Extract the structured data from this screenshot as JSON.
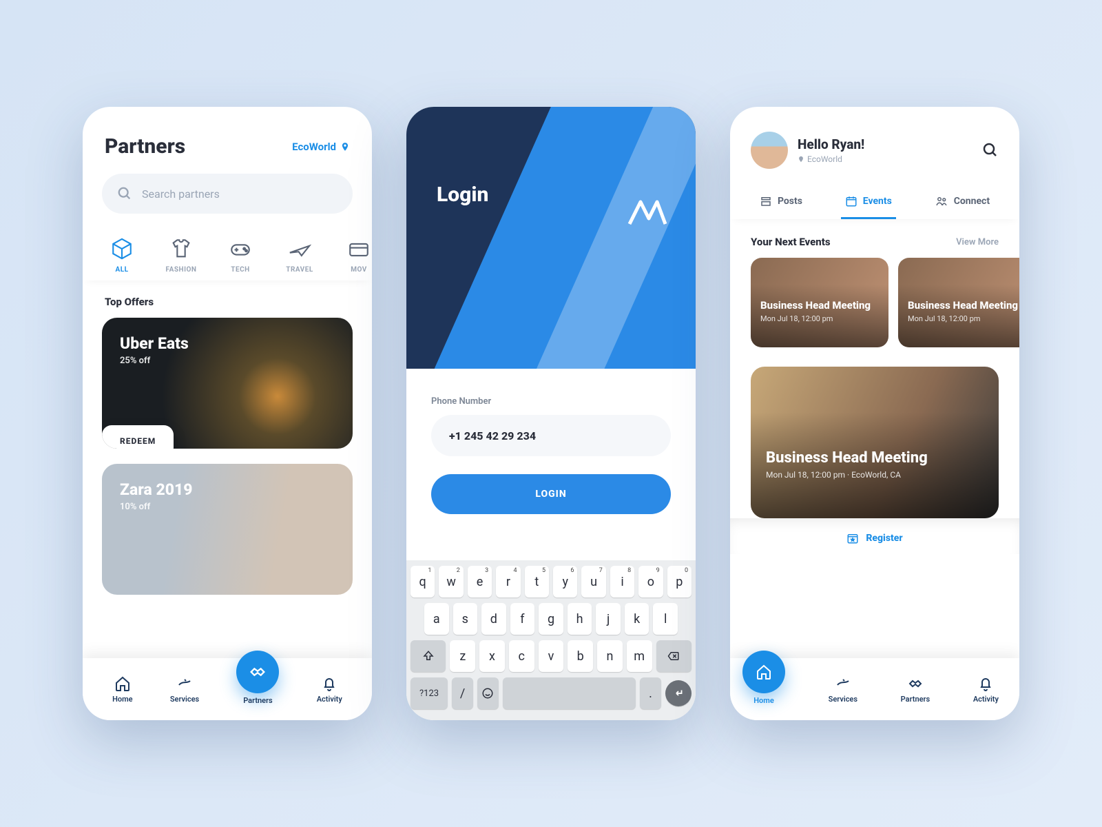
{
  "partners": {
    "title": "Partners",
    "location": "EcoWorld",
    "search_placeholder": "Search partners",
    "categories": [
      {
        "label": "ALL",
        "icon": "box-icon",
        "active": true
      },
      {
        "label": "FASHION",
        "icon": "tshirt-icon"
      },
      {
        "label": "TECH",
        "icon": "gamepad-icon"
      },
      {
        "label": "TRAVEL",
        "icon": "plane-icon"
      },
      {
        "label": "MOV",
        "icon": "ticket-icon"
      }
    ],
    "top_offers_title": "Top Offers",
    "offers": [
      {
        "name": "Uber Eats",
        "discount": "25% off",
        "redeem": "REDEEM"
      },
      {
        "name": "Zara 2019",
        "discount": "10% off"
      }
    ],
    "nav": {
      "home": "Home",
      "services": "Services",
      "partners": "Partners",
      "activity": "Activity"
    }
  },
  "login": {
    "title": "Login",
    "phone_label": "Phone Number",
    "phone_value": "+1 245 42 29 234",
    "button": "LOGIN",
    "keyboard": {
      "row1": [
        "q",
        "w",
        "e",
        "r",
        "t",
        "y",
        "u",
        "i",
        "o",
        "p"
      ],
      "row1_sup": [
        "1",
        "2",
        "3",
        "4",
        "5",
        "6",
        "7",
        "8",
        "9",
        "0"
      ],
      "row2": [
        "a",
        "s",
        "d",
        "f",
        "g",
        "h",
        "j",
        "k",
        "l"
      ],
      "row3": [
        "z",
        "x",
        "c",
        "v",
        "b",
        "n",
        "m"
      ],
      "symbols": "?123",
      "slash": "/",
      "dot": "."
    }
  },
  "home": {
    "greeting": "Hello Ryan!",
    "location": "EcoWorld",
    "tabs": {
      "posts": "Posts",
      "events": "Events",
      "connect": "Connect"
    },
    "section_title": "Your Next Events",
    "view_more": "View More",
    "events": [
      {
        "title": "Business Head Meeting",
        "time": "Mon Jul 18, 12:00 pm"
      },
      {
        "title": "Business Head Meeting",
        "time": "Mon Jul 18, 12:00 pm"
      }
    ],
    "feature": {
      "title": "Business Head Meeting",
      "meta": "Mon Jul 18, 12:00 pm · EcoWorld, CA"
    },
    "register": "Register",
    "nav": {
      "home": "Home",
      "services": "Services",
      "partners": "Partners",
      "activity": "Activity"
    }
  }
}
